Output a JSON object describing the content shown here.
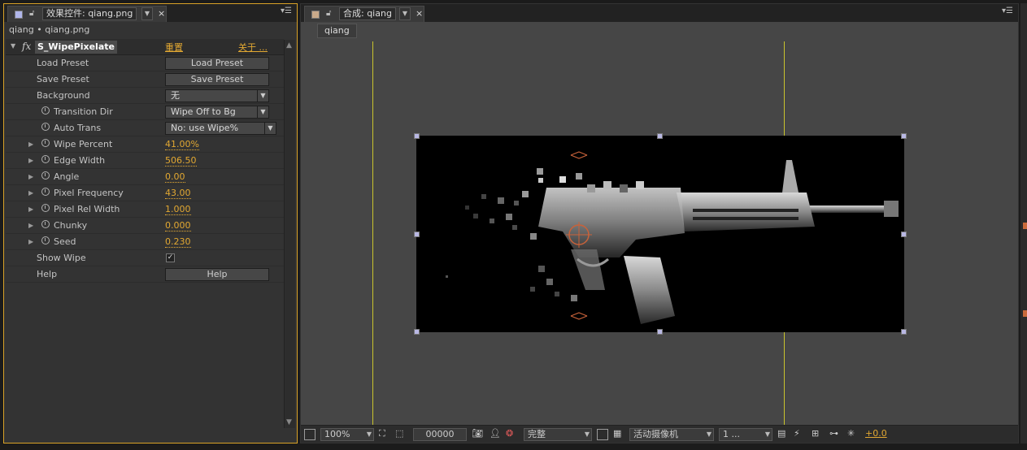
{
  "effects_panel": {
    "tab_title": "效果控件: qiang.png",
    "breadcrumb": "qiang • qiang.png",
    "effect_name": "S_WipePixelate",
    "reset_label": "重置",
    "about_label": "关于 ...",
    "rows": {
      "load_preset": {
        "label": "Load Preset",
        "button": "Load Preset"
      },
      "save_preset": {
        "label": "Save Preset",
        "button": "Save Preset"
      },
      "background": {
        "label": "Background",
        "value": "无"
      },
      "transition_dir": {
        "label": "Transition Dir",
        "value": "Wipe Off to Bg"
      },
      "auto_trans": {
        "label": "Auto Trans",
        "value": "No: use Wipe%"
      },
      "wipe_percent": {
        "label": "Wipe Percent",
        "value": "41.00%"
      },
      "edge_width": {
        "label": "Edge Width",
        "value": "506.50"
      },
      "angle": {
        "label": "Angle",
        "value": "0.00"
      },
      "pixel_frequency": {
        "label": "Pixel Frequency",
        "value": "43.00"
      },
      "pixel_rel_width": {
        "label": "Pixel Rel Width",
        "value": "1.000"
      },
      "chunky": {
        "label": "Chunky",
        "value": "0.000"
      },
      "seed": {
        "label": "Seed",
        "value": "0.230"
      },
      "show_wipe": {
        "label": "Show Wipe",
        "checked": true,
        "check_glyph": "✓"
      },
      "help": {
        "label": "Help",
        "button": "Help"
      }
    }
  },
  "composition_panel": {
    "tab_title": "合成: qiang",
    "subtab": "qiang",
    "toolbar": {
      "zoom": "100%",
      "timecode": "00000",
      "resolution": "完整",
      "camera": "活动摄像机",
      "views": "1 ...",
      "exposure": "+0.0"
    }
  },
  "icons": {
    "lock": "lock-icon",
    "close": "close-icon",
    "panel_menu": "panel-menu-icon",
    "stopwatch": "stopwatch-icon"
  },
  "colors": {
    "accent_orange": "#e2a832",
    "guide_yellow": "#c9c42d",
    "handle_lavender": "#b9b8e4",
    "panel_highlight": "#d9a227"
  }
}
